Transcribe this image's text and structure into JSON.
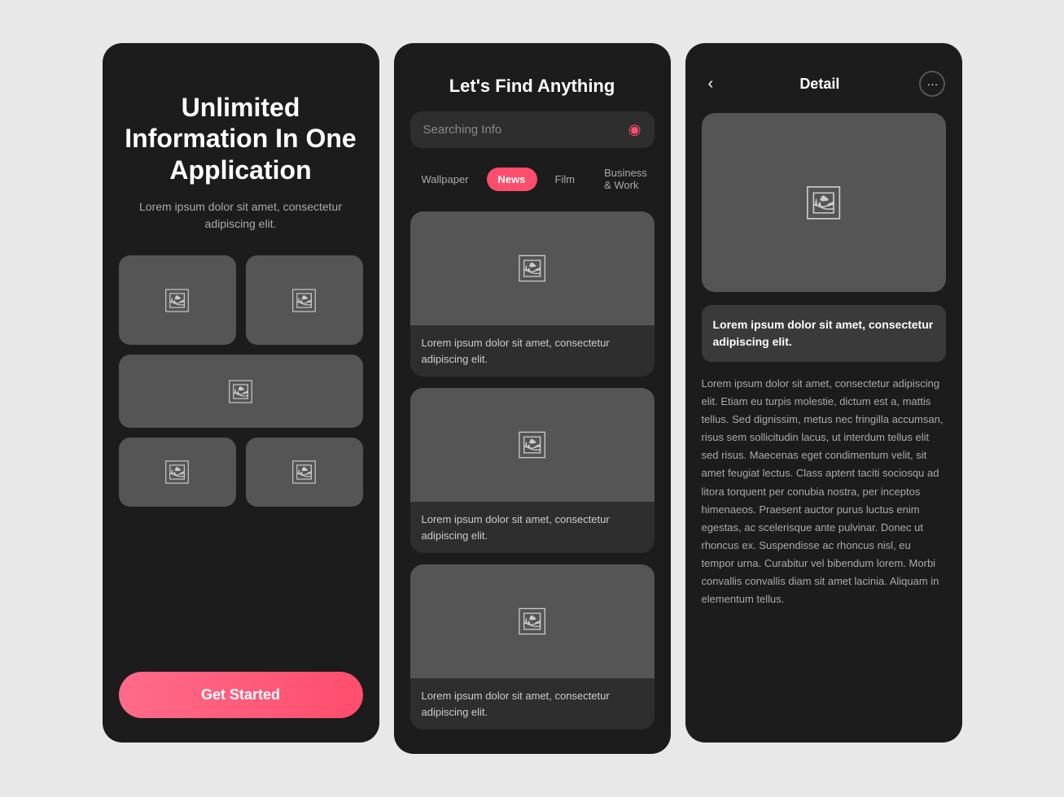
{
  "screen1": {
    "title": "Unlimited Information In One Application",
    "subtitle": "Lorem ipsum dolor sit amet, consectetur adipiscing elit.",
    "cta_label": "Get Started"
  },
  "screen2": {
    "header": "Let's Find Anything",
    "search_placeholder": "Searching Info",
    "filter_tabs": [
      {
        "label": "Wallpaper",
        "active": false
      },
      {
        "label": "News",
        "active": true
      },
      {
        "label": "Film",
        "active": false
      },
      {
        "label": "Business & Work",
        "active": false
      }
    ],
    "cards": [
      {
        "text": "Lorem ipsum dolor sit amet, consectetur adipiscing elit."
      },
      {
        "text": "Lorem ipsum dolor sit amet, consectetur adipiscing elit."
      },
      {
        "text": "Lorem ipsum dolor sit amet, consectetur adipiscing elit."
      }
    ]
  },
  "screen3": {
    "title": "Detail",
    "caption": "Lorem ipsum dolor sit amet, consectetur adipiscing elit.",
    "body": "Lorem ipsum dolor sit amet, consectetur adipiscing elit. Etiam eu turpis molestie, dictum est a, mattis tellus. Sed dignissim, metus nec fringilla accumsan, risus sem sollicitudin lacus, ut interdum tellus elit sed risus. Maecenas eget condimentum velit, sit amet feugiat lectus. Class aptent taciti sociosqu ad litora torquent per conubia nostra, per inceptos himenaeos. Praesent auctor purus luctus enim egestas, ac scelerisque ante pulvinar. Donec ut rhoncus ex. Suspendisse ac rhoncus nisl, eu tempor urna. Curabitur vel bibendum lorem. Morbi convallis convallis diam sit amet lacinia. Aliquam in elementum tellus."
  },
  "icons": {
    "image": "🖼",
    "search": "🔍",
    "back": "‹",
    "more": "···"
  }
}
